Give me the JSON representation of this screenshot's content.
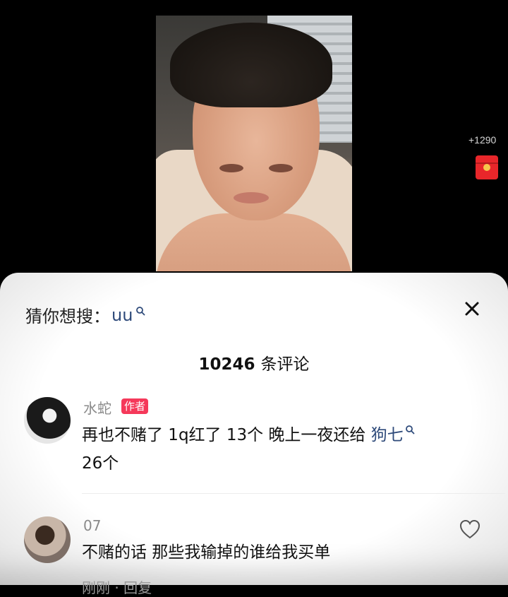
{
  "side": {
    "gift_count": "+1290",
    "gift_icon": "red-envelope-icon"
  },
  "panel": {
    "search_prefix": "猜你想搜：",
    "search_keyword": "uu",
    "comment_count_number": "10246",
    "comment_count_suffix": "条评论"
  },
  "comments": [
    {
      "username": "水蛇",
      "badge": "作者",
      "text": "再也不赌了 1q红了 13个 晚上一夜还给 ",
      "link": "狗七",
      "text_tail": "26个"
    },
    {
      "username": "07",
      "text": "不赌的话 那些我输掉的谁给我买单"
    }
  ],
  "footer_peek": "刚刚 · 回复"
}
